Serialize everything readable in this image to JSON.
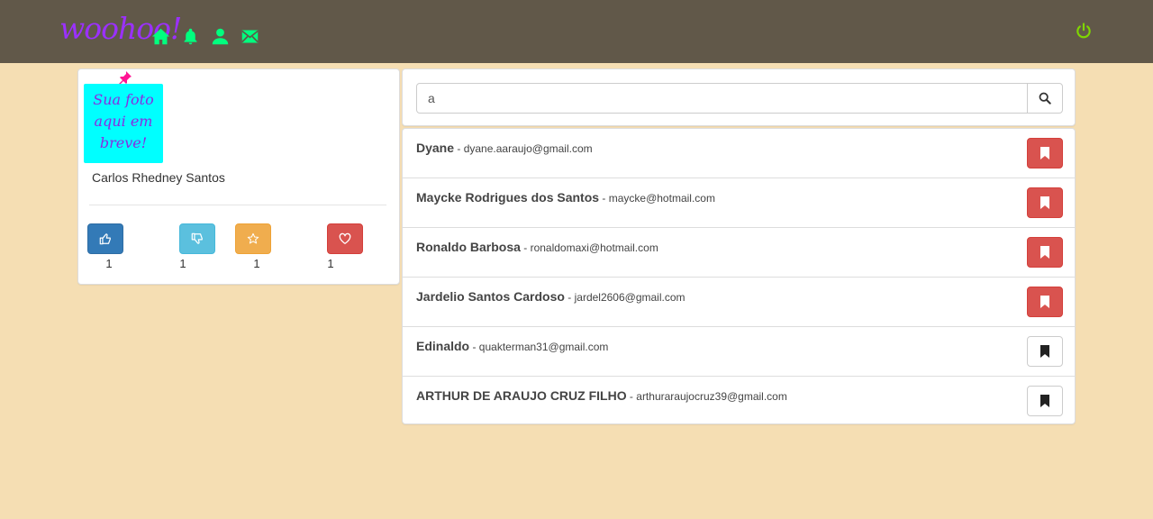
{
  "brand": {
    "logo_text": "woohoo!"
  },
  "nav": {
    "icons": [
      "home-icon",
      "bell-icon",
      "user-icon",
      "envelope-icon"
    ],
    "power_icon": "power-icon",
    "icon_color": "#00ff7f",
    "power_color": "#7fd600"
  },
  "profile": {
    "photo_placeholder": [
      "Sua foto",
      "aqui em",
      "breve!"
    ],
    "name": "Carlos Rhedney Santos",
    "votes": [
      {
        "icon": "thumbs-up-icon",
        "color": "#337ab7",
        "count": "1"
      },
      {
        "icon": "thumbs-down-icon",
        "color": "#5bc0de",
        "count": "1"
      },
      {
        "icon": "star-icon",
        "color": "#f0ad4e",
        "count": "1"
      },
      {
        "icon": "heart-icon",
        "color": "#d9534f",
        "count": "1"
      }
    ]
  },
  "search": {
    "value": "a",
    "button_icon": "search-icon"
  },
  "results": [
    {
      "name": "Dyane",
      "email": "dyane.aaraujo@gmail.com",
      "bookmarked": true
    },
    {
      "name": "Maycke Rodrigues dos Santos",
      "email": "maycke@hotmail.com",
      "bookmarked": true
    },
    {
      "name": "Ronaldo Barbosa",
      "email": "ronaldomaxi@hotmail.com",
      "bookmarked": true
    },
    {
      "name": "Jardelio Santos Cardoso",
      "email": "jardel2606@gmail.com",
      "bookmarked": true
    },
    {
      "name": "Edinaldo",
      "email": "quakterman31@gmail.com",
      "bookmarked": false
    },
    {
      "name": "ARTHUR DE ARAUJO CRUZ FILHO",
      "email": "arthuraraujocruz39@gmail.com",
      "bookmarked": false
    }
  ],
  "separator": " - "
}
